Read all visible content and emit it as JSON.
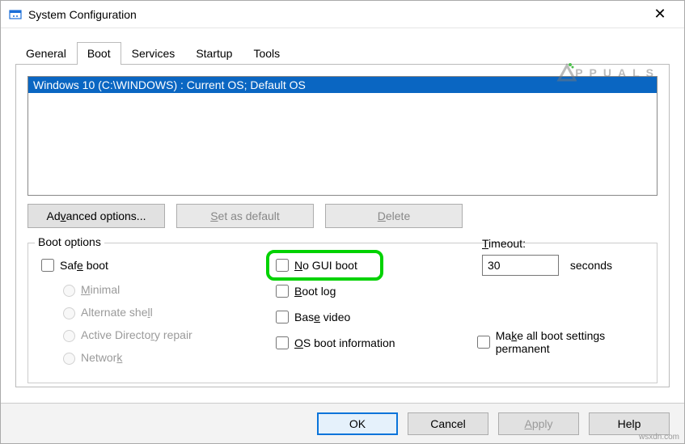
{
  "window": {
    "title": "System Configuration"
  },
  "tabs": [
    "General",
    "Boot",
    "Services",
    "Startup",
    "Tools"
  ],
  "active_tab": "Boot",
  "boot_list": {
    "selected": "Windows 10 (C:\\WINDOWS) : Current OS; Default OS"
  },
  "buttons": {
    "advanced": {
      "pre": "Ad",
      "u": "v",
      "post": "anced options..."
    },
    "set_default": {
      "pre": "",
      "u": "S",
      "post": "et as default"
    },
    "delete": {
      "pre": "",
      "u": "D",
      "post": "elete"
    }
  },
  "group_label": "Boot options",
  "col1": {
    "safe_boot": {
      "pre": "Saf",
      "u": "e",
      "post": " boot"
    },
    "minimal": {
      "pre": "",
      "u": "M",
      "post": "inimal"
    },
    "alt_shell": {
      "pre": "Alternate she",
      "u": "l",
      "post": "l"
    },
    "ad_repair": {
      "pre": "Active Directo",
      "u": "r",
      "post": "y repair"
    },
    "network": {
      "pre": "Networ",
      "u": "k",
      "post": ""
    }
  },
  "col2": {
    "no_gui": {
      "pre": "",
      "u": "N",
      "post": "o GUI boot"
    },
    "boot_log": {
      "pre": "",
      "u": "B",
      "post": "oot log"
    },
    "base_video": {
      "pre": "Bas",
      "u": "e",
      "post": " video"
    },
    "os_info": {
      "pre": "",
      "u": "O",
      "post": "S boot information"
    }
  },
  "timeout": {
    "label_pre": "",
    "label_u": "T",
    "label_post": "imeout:",
    "value": "30",
    "unit": "seconds"
  },
  "permanent": {
    "pre": "Ma",
    "u": "k",
    "post": "e all boot settings permanent"
  },
  "bottom": {
    "ok": "OK",
    "cancel": "Cancel",
    "apply": {
      "pre": "",
      "u": "A",
      "post": "pply"
    },
    "help": "Help"
  },
  "watermark": "PPUALS",
  "credit": "wsxdn.com"
}
